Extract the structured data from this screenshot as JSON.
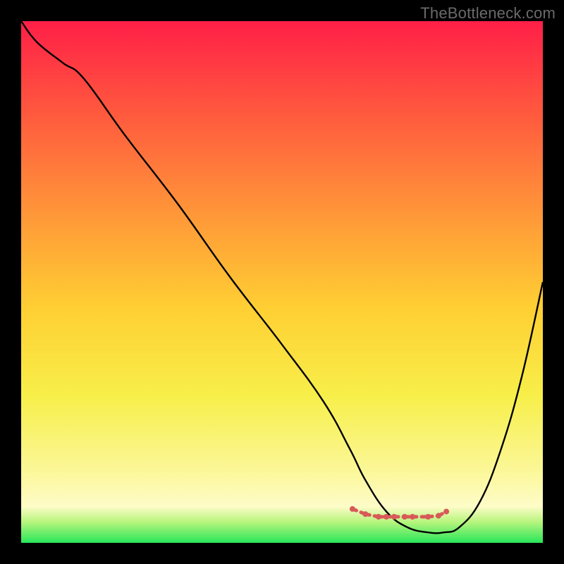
{
  "watermark": "TheBottleneck.com",
  "colors": {
    "background": "#000000",
    "curve": "#000000",
    "marker": "#d85a58",
    "gradient_top": "#ff1f47",
    "gradient_mid_upper": "#ff7a3a",
    "gradient_mid": "#ffd033",
    "gradient_mid_lower": "#f7f35a",
    "gradient_lower": "#fdfbae",
    "gradient_bottom": "#28e65a"
  },
  "chart_data": {
    "type": "line",
    "title": "",
    "xlabel": "",
    "ylabel": "",
    "xlim": [
      0,
      100
    ],
    "ylim": [
      0,
      100
    ],
    "series": [
      {
        "name": "bottleneck-curve",
        "x": [
          0,
          3,
          8,
          12,
          20,
          30,
          40,
          50,
          58,
          63,
          66,
          70,
          74,
          78,
          81,
          84,
          88,
          92,
          96,
          100
        ],
        "y": [
          100,
          96,
          92,
          89,
          78,
          65,
          51,
          38,
          27,
          18,
          12,
          6,
          3,
          2,
          2,
          3,
          8,
          18,
          32,
          50
        ]
      }
    ],
    "markers": {
      "name": "optimal-range",
      "x": [
        63.5,
        66,
        68.5,
        70,
        71.5,
        73.5,
        75,
        78,
        80,
        81.5
      ],
      "y": [
        6.5,
        5.5,
        5,
        5,
        5,
        5,
        5,
        5,
        5.2,
        6
      ]
    },
    "gradient_stops": [
      {
        "offset": 0,
        "color": "#ff1f47"
      },
      {
        "offset": 18,
        "color": "#ff5a3e"
      },
      {
        "offset": 38,
        "color": "#ff9a38"
      },
      {
        "offset": 55,
        "color": "#ffcf33"
      },
      {
        "offset": 72,
        "color": "#f7ef4a"
      },
      {
        "offset": 86,
        "color": "#fbf797"
      },
      {
        "offset": 93,
        "color": "#fefcc8"
      },
      {
        "offset": 96,
        "color": "#b7f57d"
      },
      {
        "offset": 100,
        "color": "#28e65a"
      }
    ]
  }
}
